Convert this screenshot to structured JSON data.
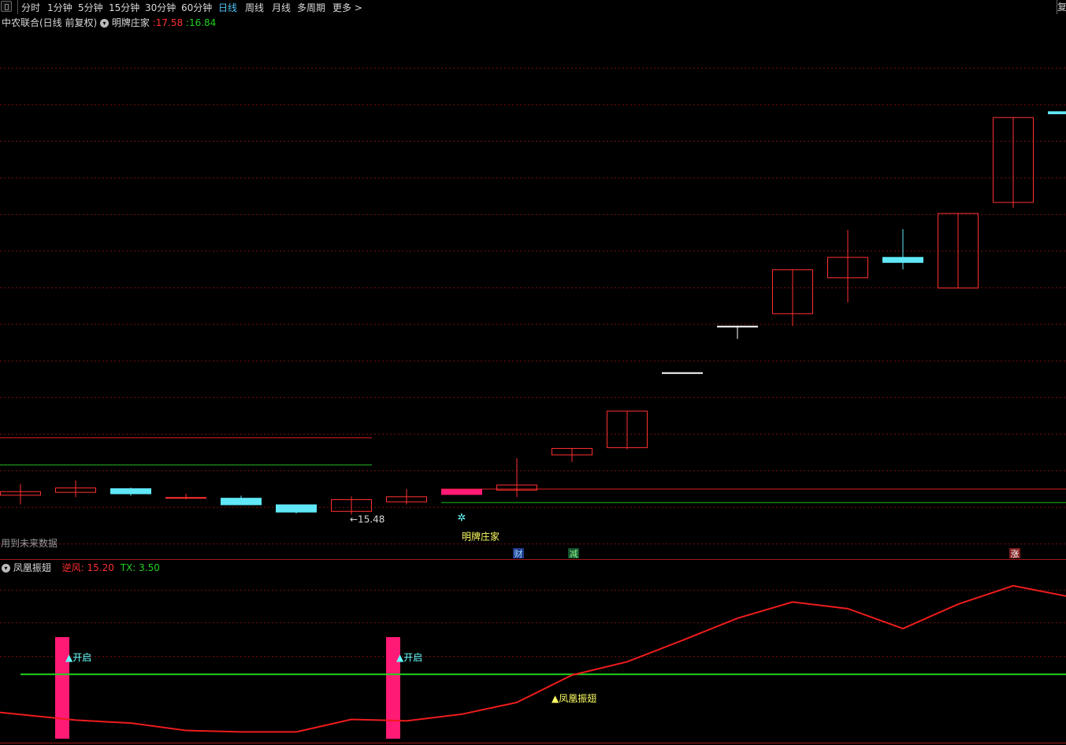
{
  "toolbar": {
    "items": [
      {
        "label": "分时"
      },
      {
        "label": "1分钟"
      },
      {
        "label": "5分钟"
      },
      {
        "label": "15分钟"
      },
      {
        "label": "30分钟"
      },
      {
        "label": "60分钟"
      },
      {
        "label": "日线",
        "active": true
      },
      {
        "label": "周线"
      },
      {
        "label": "月线"
      },
      {
        "label": "多周期"
      },
      {
        "label": "更多 >"
      }
    ],
    "right_label": "复"
  },
  "main_header": {
    "stock": "中农联合(日线 前复权)",
    "indicator": "明牌庄家",
    "value1": ":17.58",
    "value2": ":16.84"
  },
  "main_chart": {
    "candles": [
      {
        "o": 16.0,
        "c": 16.12,
        "h": 16.32,
        "l": 15.76
      },
      {
        "o": 16.08,
        "c": 16.22,
        "h": 16.42,
        "l": 15.96
      },
      {
        "o": 16.2,
        "c": 16.04,
        "h": 16.22,
        "l": 16.0
      },
      {
        "o": 15.94,
        "c": 15.96,
        "h": 16.05,
        "l": 15.9
      },
      {
        "o": 15.94,
        "c": 15.74,
        "h": 16.0,
        "l": 15.74
      },
      {
        "o": 15.76,
        "c": 15.54,
        "h": 15.76,
        "l": 15.51
      },
      {
        "o": 15.56,
        "c": 15.9,
        "h": 15.98,
        "l": 15.48
      },
      {
        "o": 15.82,
        "c": 15.98,
        "h": 16.18,
        "l": 15.76
      },
      {
        "o": 16.02,
        "c": 16.18,
        "h": 16.18,
        "l": 16.02
      },
      {
        "o": 16.14,
        "c": 16.3,
        "h": 17.02,
        "l": 15.96
      },
      {
        "o": 17.1,
        "c": 17.3,
        "h": 17.3,
        "l": 16.92
      },
      {
        "o": 17.3,
        "c": 18.32,
        "h": 18.32,
        "l": 17.27
      },
      {
        "o": 19.37,
        "c": 19.37,
        "h": 19.37,
        "l": 19.37
      },
      {
        "o": 20.64,
        "c": 20.64,
        "h": 20.64,
        "l": 20.28
      },
      {
        "o": 20.96,
        "c": 22.18,
        "h": 22.18,
        "l": 20.64
      },
      {
        "o": 21.94,
        "c": 22.52,
        "h": 23.26,
        "l": 21.28
      },
      {
        "o": 22.52,
        "c": 22.36,
        "h": 23.28,
        "l": 22.18
      },
      {
        "o": 21.66,
        "c": 23.72,
        "h": 23.72,
        "l": 21.66
      },
      {
        "o": 24.0,
        "c": 26.34,
        "h": 26.34,
        "l": 23.86
      },
      {
        "o": 26.5,
        "c": 26.42,
        "h": 26.5,
        "l": 26.42
      }
    ],
    "special_candle_index": 8,
    "y_range": [
      14.48,
      28.68
    ],
    "gridlines": [
      27.68,
      26.68,
      25.68,
      24.68,
      23.68,
      22.68,
      21.68,
      20.68,
      19.68,
      18.68,
      17.68,
      16.68,
      15.68,
      14.68
    ],
    "lines": [
      {
        "value": 17.58,
        "from": 0,
        "to": 6,
        "color": "#e02020"
      },
      {
        "value": 16.84,
        "from": 0,
        "to": 6,
        "color": "#20c020"
      },
      {
        "value": 16.18,
        "from": 8,
        "to": 19,
        "color": "#e02020"
      },
      {
        "value": 15.81,
        "from": 8,
        "to": 19,
        "color": "#20c020"
      }
    ],
    "low_marker": {
      "label": "←15.48",
      "index": 6,
      "value": 15.48
    },
    "signal_label": {
      "text": "明牌庄家",
      "index": 8
    },
    "bottom_note": "用到未来数据",
    "badges": [
      {
        "text": "财",
        "index": 9,
        "color": "#1e3a8a",
        "fg": "#9fd8ff"
      },
      {
        "text": "减",
        "index": 10,
        "color": "#14532d",
        "fg": "#8ff58f"
      },
      {
        "text": "涨",
        "index": 18,
        "color": "#7f1d1d",
        "fg": "#ffffff"
      }
    ]
  },
  "sub_header": {
    "name": "凤凰振翅",
    "line1_label": "逆风: 15.20",
    "line2_label": "TX: 3.50"
  },
  "sub_chart": {
    "y_range": [
      -1.07,
      10.34
    ],
    "red_line": [
      1.85,
      0.8,
      0.4,
      -0.6,
      -0.8,
      -0.8,
      0.9,
      0.7,
      1.6,
      3.2,
      6.9,
      8.7,
      11.6,
      14.6,
      16.8,
      15.9,
      13.2,
      16.5,
      19.0,
      17.6
    ],
    "red_line_scale": 0.5,
    "green_level": 3.5,
    "gridlines": [
      9.2,
      7.0,
      4.7
    ],
    "bars": [
      {
        "index": 1,
        "label": "▲开启"
      },
      {
        "index": 7,
        "label": "▲开启"
      }
    ],
    "annotation": {
      "text": "▲凤凰振翅",
      "index": 10
    }
  },
  "colors": {
    "up": "#ff3030",
    "down": "#60e8f8",
    "doji": "#ffffff",
    "special": "#ff1a75",
    "grid": "#7a1010",
    "signal_text": "#ffff66",
    "sub_label": "#66ffff"
  }
}
